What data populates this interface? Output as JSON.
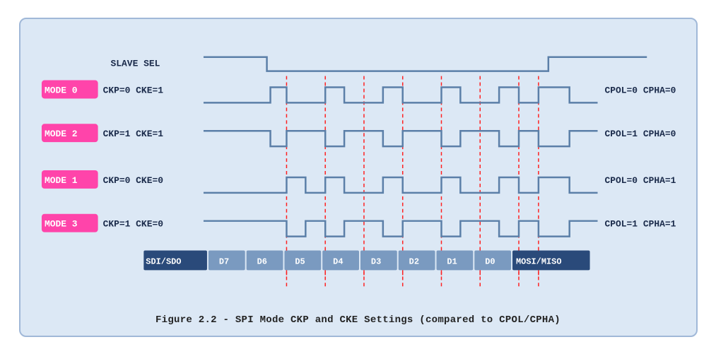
{
  "caption": "Figure 2.2 - SPI Mode CKP and CKE Settings (compared to CPOL/CPHA)",
  "diagram": {
    "slave_sel_label": "SLAVE SEL",
    "mode0_label": "MODE 0",
    "mode0_params": "CKP=0  CKE=1",
    "mode0_cpol": "CPOL=0  CPHA=0",
    "mode2_label": "MODE 2",
    "mode2_params": "CKP=1  CKE=1",
    "mode2_cpol": "CPOL=1  CPHA=0",
    "mode1_label": "MODE 1",
    "mode1_params": "CKP=0  CKE=0",
    "mode1_cpol": "CPOL=0  CPHA=1",
    "mode3_label": "MODE 3",
    "mode3_params": "CKP=1  CKE=0",
    "mode3_cpol": "CPOL=1  CPHA=1",
    "data_bits": [
      "SDI/SDO",
      "D7",
      "D6",
      "D5",
      "D4",
      "D3",
      "D2",
      "D1",
      "D0",
      "MOSI/MISO"
    ]
  }
}
